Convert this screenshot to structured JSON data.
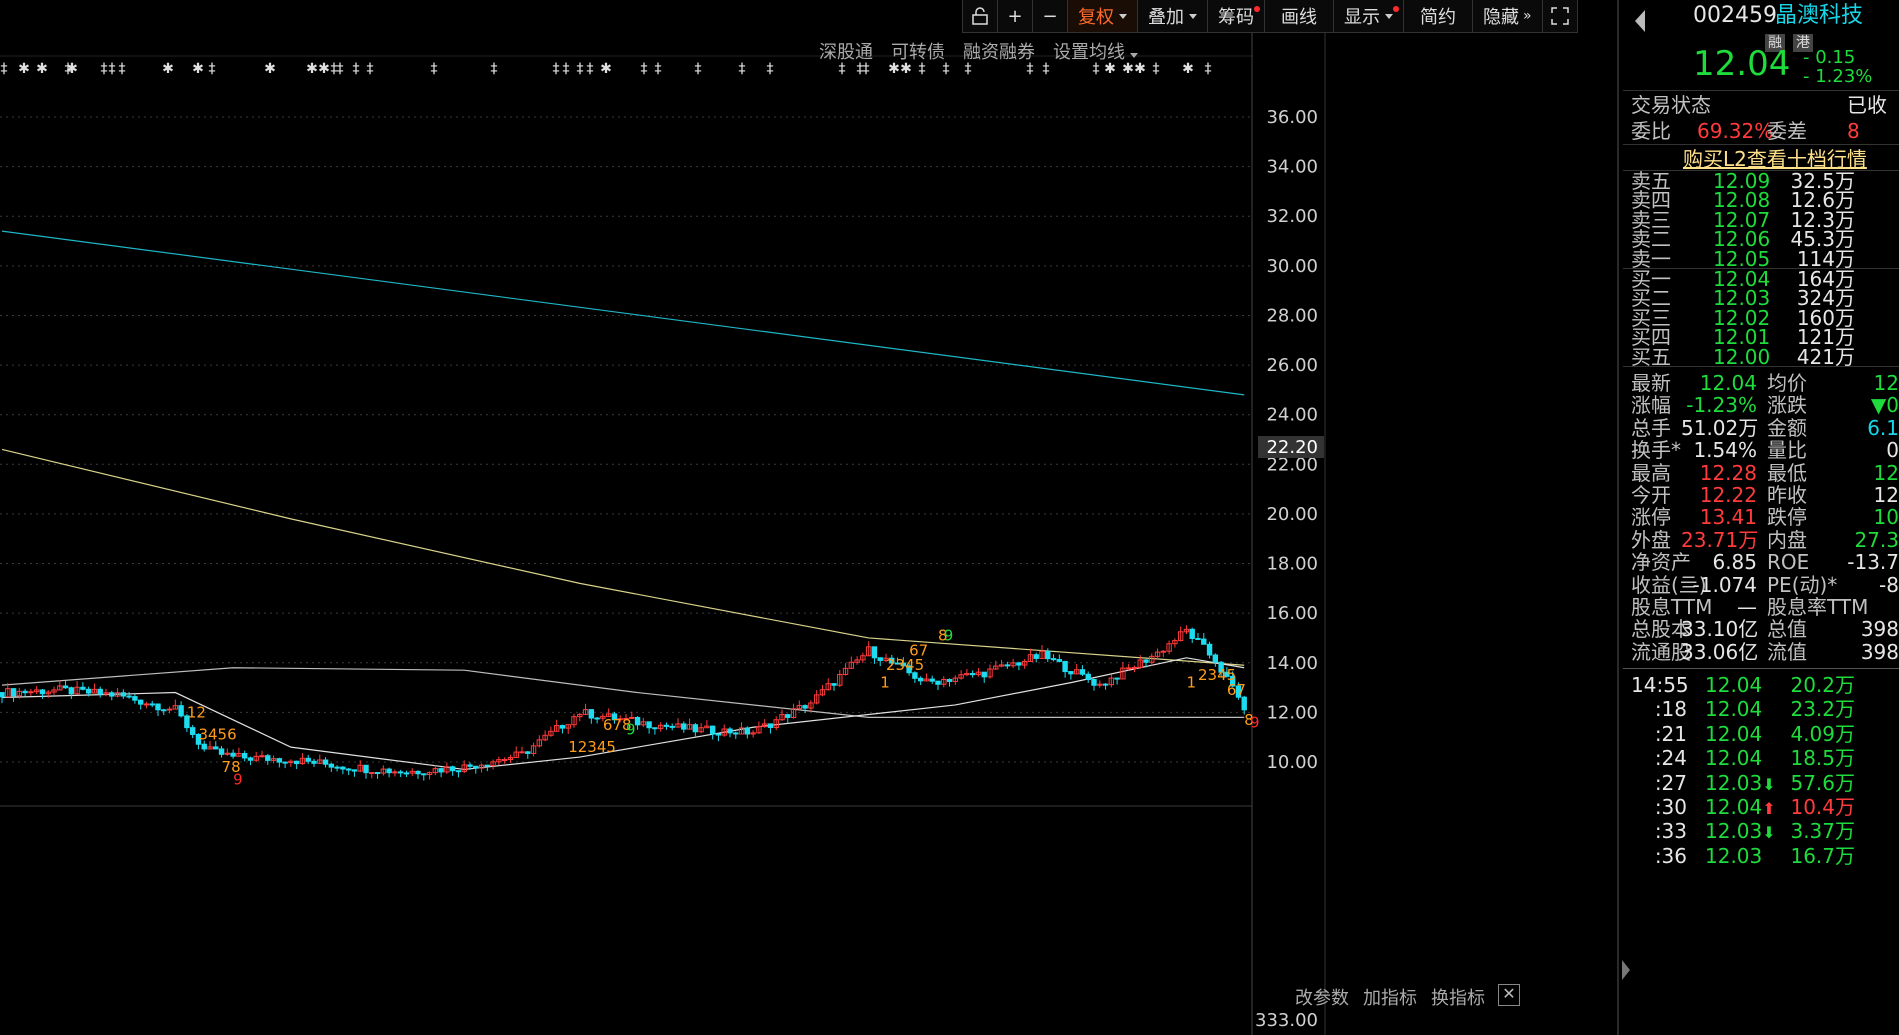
{
  "toolbar": {
    "unlock_icon": "unlock-icon",
    "plus_icon": "plus-icon",
    "minus_icon": "minus-icon",
    "fuquan": "复权",
    "diejia": "叠加",
    "chouma": "筹码",
    "huaxian": "画线",
    "xianshi": "显示",
    "jianyue": "简约",
    "yincang": "隐藏",
    "expand_icon": "expand-icon"
  },
  "sublinks": [
    "深股通",
    "可转债",
    "融资融券",
    "设置均线"
  ],
  "bottom_links": [
    "改参数",
    "加指标",
    "换指标"
  ],
  "close_label": "✕",
  "price_axis": {
    "ticks": [
      "36.00",
      "34.00",
      "32.00",
      "30.00",
      "28.00",
      "26.00",
      "24.00",
      "22.00",
      "20.00",
      "18.00",
      "16.00",
      "14.00",
      "12.00",
      "10.00"
    ],
    "highlight": "22.20",
    "volume_tick": "333.00"
  },
  "chart_data": {
    "type": "line",
    "ylim": [
      8,
      38
    ],
    "price_points": [
      {
        "x": 0,
        "y": 12.8
      },
      {
        "x": 10,
        "y": 12.9
      },
      {
        "x": 20,
        "y": 12.7
      },
      {
        "x": 30,
        "y": 12.1
      },
      {
        "x": 35,
        "y": 10.5
      },
      {
        "x": 40,
        "y": 10.2
      },
      {
        "x": 50,
        "y": 10.1
      },
      {
        "x": 60,
        "y": 9.8
      },
      {
        "x": 70,
        "y": 9.6
      },
      {
        "x": 80,
        "y": 9.8
      },
      {
        "x": 90,
        "y": 10.3
      },
      {
        "x": 100,
        "y": 12.0
      },
      {
        "x": 110,
        "y": 11.6
      },
      {
        "x": 120,
        "y": 11.3
      },
      {
        "x": 130,
        "y": 11.2
      },
      {
        "x": 140,
        "y": 12.4
      },
      {
        "x": 150,
        "y": 14.5
      },
      {
        "x": 160,
        "y": 13.2
      },
      {
        "x": 170,
        "y": 13.6
      },
      {
        "x": 180,
        "y": 14.3
      },
      {
        "x": 190,
        "y": 13.1
      },
      {
        "x": 200,
        "y": 14.4
      },
      {
        "x": 205,
        "y": 15.3
      },
      {
        "x": 210,
        "y": 14.1
      },
      {
        "x": 215,
        "y": 12.2
      }
    ],
    "ma_long_cyan": [
      {
        "x": 0,
        "y": 31.4
      },
      {
        "x": 215,
        "y": 24.8
      }
    ],
    "ma_yellow": [
      {
        "x": 0,
        "y": 22.6
      },
      {
        "x": 50,
        "y": 19.8
      },
      {
        "x": 100,
        "y": 17.2
      },
      {
        "x": 150,
        "y": 15.0
      },
      {
        "x": 215,
        "y": 13.9
      }
    ],
    "ma_white_1": [
      {
        "x": 0,
        "y": 13.1
      },
      {
        "x": 40,
        "y": 13.8
      },
      {
        "x": 80,
        "y": 13.7
      },
      {
        "x": 110,
        "y": 12.8
      },
      {
        "x": 150,
        "y": 11.8
      },
      {
        "x": 215,
        "y": 11.8
      }
    ],
    "ma_white_2": [
      {
        "x": 0,
        "y": 12.6
      },
      {
        "x": 30,
        "y": 12.8
      },
      {
        "x": 50,
        "y": 10.6
      },
      {
        "x": 80,
        "y": 9.7
      },
      {
        "x": 100,
        "y": 10.2
      },
      {
        "x": 130,
        "y": 11.4
      },
      {
        "x": 165,
        "y": 12.3
      },
      {
        "x": 185,
        "y": 13.2
      },
      {
        "x": 205,
        "y": 14.2
      },
      {
        "x": 215,
        "y": 13.8
      }
    ]
  },
  "td_labels": [
    {
      "x": 32,
      "y": 11.8,
      "t": "12",
      "c": "#ff9c1a"
    },
    {
      "x": 34,
      "y": 10.9,
      "t": "3456",
      "c": "#ff9c1a"
    },
    {
      "x": 38,
      "y": 9.6,
      "t": "78",
      "c": "#ff9c1a"
    },
    {
      "x": 40,
      "y": 9.1,
      "t": "9",
      "c": "#ff2a2a"
    },
    {
      "x": 98,
      "y": 10.4,
      "t": "12345",
      "c": "#ff9c1a"
    },
    {
      "x": 104,
      "y": 11.3,
      "t": "678",
      "c": "#ff9c1a"
    },
    {
      "x": 108,
      "y": 11.1,
      "t": "9",
      "c": "#1edc3c"
    },
    {
      "x": 152,
      "y": 13.0,
      "t": "1",
      "c": "#ff9c1a"
    },
    {
      "x": 153,
      "y": 13.7,
      "t": "2345",
      "c": "#ff9c1a"
    },
    {
      "x": 157,
      "y": 14.3,
      "t": "67",
      "c": "#ff9c1a"
    },
    {
      "x": 162,
      "y": 14.9,
      "t": "8",
      "c": "#ff9c1a"
    },
    {
      "x": 163,
      "y": 14.9,
      "t": "9",
      "c": "#1edc3c"
    },
    {
      "x": 205,
      "y": 13.0,
      "t": "1",
      "c": "#ff9c1a"
    },
    {
      "x": 207,
      "y": 13.3,
      "t": "2345",
      "c": "#ff9c1a"
    },
    {
      "x": 212,
      "y": 12.7,
      "t": "67",
      "c": "#ff9c1a"
    },
    {
      "x": 215,
      "y": 11.5,
      "t": "8",
      "c": "#ff9c1a"
    },
    {
      "x": 216,
      "y": 11.4,
      "t": "9",
      "c": "#ff2a2a"
    }
  ],
  "stock": {
    "code": "002459",
    "name": "晶澳科技",
    "tag1": "融",
    "tag2": "港",
    "price": "12.04",
    "change": "- 0.15",
    "change_pct": "- 1.23%"
  },
  "trade_status": {
    "label": "交易状态",
    "value": "已收"
  },
  "weibi": {
    "label": "委比",
    "value": "69.32%",
    "label2": "委差",
    "value2": "8"
  },
  "l2_link": "购买L2查看十档行情",
  "asks": [
    {
      "label": "卖五",
      "price": "12.09",
      "vol": "32.5万"
    },
    {
      "label": "卖四",
      "price": "12.08",
      "vol": "12.6万"
    },
    {
      "label": "卖三",
      "price": "12.07",
      "vol": "12.3万"
    },
    {
      "label": "卖二",
      "price": "12.06",
      "vol": "45.3万"
    },
    {
      "label": "卖一",
      "price": "12.05",
      "vol": "114万"
    }
  ],
  "bids": [
    {
      "label": "买一",
      "price": "12.04",
      "vol": "164万"
    },
    {
      "label": "买二",
      "price": "12.03",
      "vol": "324万"
    },
    {
      "label": "买三",
      "price": "12.02",
      "vol": "160万"
    },
    {
      "label": "买四",
      "price": "12.01",
      "vol": "121万"
    },
    {
      "label": "买五",
      "price": "12.00",
      "vol": "421万"
    }
  ],
  "stats": [
    {
      "l1": "最新",
      "v1": "12.04",
      "c1": "g",
      "l2": "均价",
      "v2": "12",
      "c2": "g"
    },
    {
      "l1": "涨幅",
      "v1": "-1.23%",
      "c1": "g",
      "l2": "涨跌",
      "v2": "▼0",
      "c2": "g"
    },
    {
      "l1": "总手",
      "v1": "51.02万",
      "c1": "w",
      "l2": "金额",
      "v2": "6.1",
      "c2": "c"
    },
    {
      "l1": "换手*",
      "v1": "1.54%",
      "c1": "w",
      "l2": "量比",
      "v2": "0",
      "c2": "w"
    },
    {
      "l1": "最高",
      "v1": "12.28",
      "c1": "r",
      "l2": "最低",
      "v2": "12",
      "c2": "g"
    },
    {
      "l1": "今开",
      "v1": "12.22",
      "c1": "r",
      "l2": "昨收",
      "v2": "12",
      "c2": "w"
    },
    {
      "l1": "涨停",
      "v1": "13.41",
      "c1": "r",
      "l2": "跌停",
      "v2": "10",
      "c2": "g"
    },
    {
      "l1": "外盘",
      "v1": "23.71万",
      "c1": "r",
      "l2": "内盘",
      "v2": "27.3",
      "c2": "g"
    },
    {
      "l1": "净资产",
      "v1": "6.85",
      "c1": "w",
      "l2": "ROE",
      "v2": "-13.7",
      "c2": "w"
    },
    {
      "l1": "收益(亖)",
      "v1": "-1.074",
      "c1": "w",
      "l2": "PE(动)*",
      "v2": "-8",
      "c2": "w"
    },
    {
      "l1": "股息TTM",
      "v1": "—",
      "c1": "w",
      "l2": "股息率TTM",
      "v2": "",
      "c2": "w"
    },
    {
      "l1": "总股本",
      "v1": "33.10亿",
      "c1": "w",
      "l2": "总值",
      "v2": "398",
      "c2": "w"
    },
    {
      "l1": "流通股",
      "v1": "33.06亿",
      "c1": "w",
      "l2": "流值",
      "v2": "398",
      "c2": "w"
    }
  ],
  "ticks": [
    {
      "t": "14:55",
      "p": "12.04",
      "v": "20.2万",
      "arrow": "",
      "vc": "g"
    },
    {
      "t": ":18",
      "p": "12.04",
      "v": "23.2万",
      "arrow": "",
      "vc": "g"
    },
    {
      "t": ":21",
      "p": "12.04",
      "v": "4.09万",
      "arrow": "",
      "vc": "g"
    },
    {
      "t": ":24",
      "p": "12.04",
      "v": "18.5万",
      "arrow": "",
      "vc": "g"
    },
    {
      "t": ":27",
      "p": "12.03",
      "v": "57.6万",
      "arrow": "⬇",
      "vc": "g"
    },
    {
      "t": ":30",
      "p": "12.04",
      "v": "10.4万",
      "arrow": "⬆",
      "vc": "r"
    },
    {
      "t": ":33",
      "p": "12.03",
      "v": "3.37万",
      "arrow": "⬇",
      "vc": "g"
    },
    {
      "t": ":36",
      "p": "12.03",
      "v": "16.7万",
      "arrow": "",
      "vc": "g"
    }
  ],
  "colors": {
    "up": "#ff3b3b",
    "down": "#1edc3c",
    "cyan": "#16d6e8",
    "bg": "#000000"
  }
}
